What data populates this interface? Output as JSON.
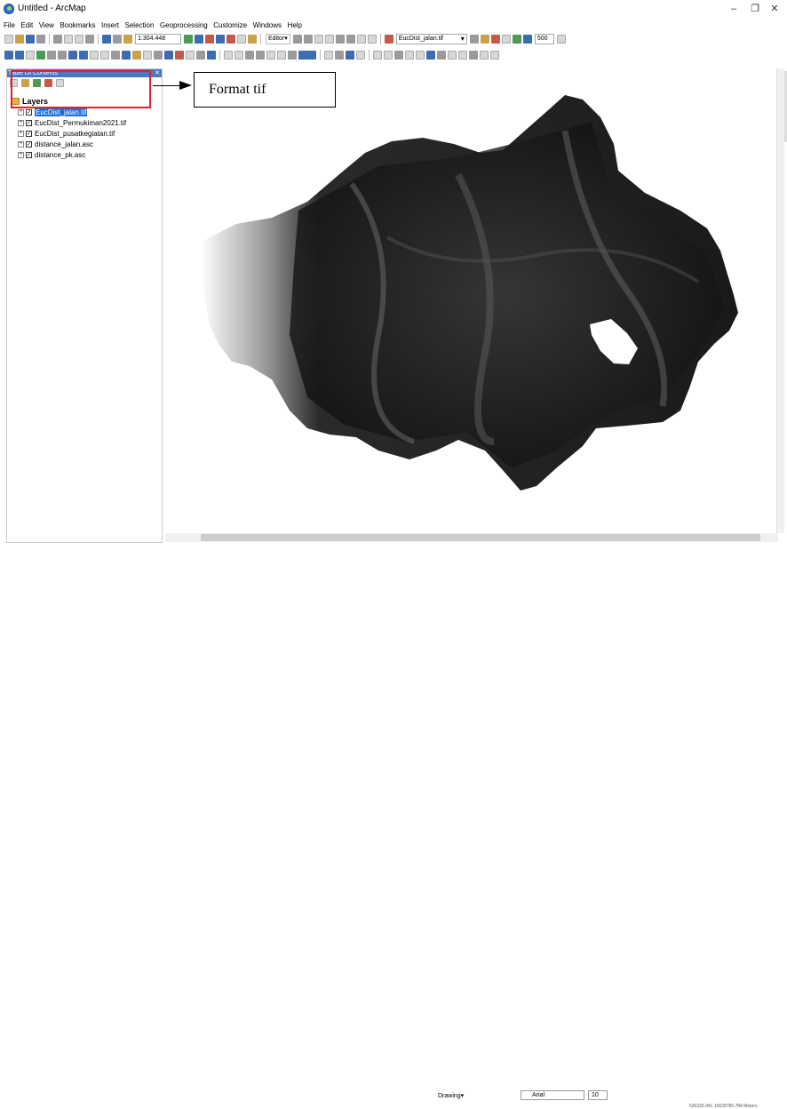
{
  "window": {
    "title": "Untitled - ArcMap",
    "min_icon": "–",
    "max_icon": "❐",
    "close_icon": "✕"
  },
  "menu": [
    "File",
    "Edit",
    "View",
    "Bookmarks",
    "Insert",
    "Selection",
    "Geoprocessing",
    "Customize",
    "Windows",
    "Help"
  ],
  "toolbar": {
    "scale_value": "1:304.448",
    "editor_label": "Editor▾",
    "layer_dropdown": "EucDist_jalan.tif",
    "small_value": "500"
  },
  "toc": {
    "title": "Table Of Contents",
    "root": "Layers",
    "layers": [
      {
        "name": "EucDist_jalan.tif",
        "selected": true
      },
      {
        "name": "EucDist_Permukiman2021.tif",
        "selected": false
      },
      {
        "name": "EucDist_pusatkegiatan.tif",
        "selected": false
      },
      {
        "name": "distance_jalan.asc",
        "selected": false
      },
      {
        "name": "distance_pk.asc",
        "selected": false
      }
    ]
  },
  "annotation": {
    "text": "Format tif",
    "color": "#e0202a"
  },
  "drawing": {
    "label": "Drawing▾",
    "font": "Arial",
    "size": "10"
  },
  "status": {
    "coords": "536335.941  10028785.784 Meters"
  }
}
